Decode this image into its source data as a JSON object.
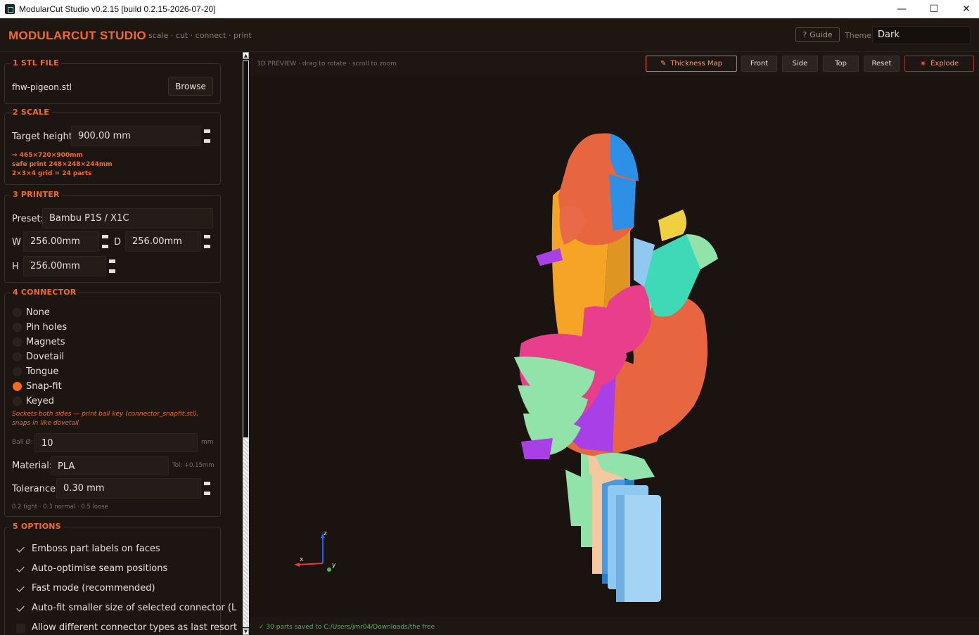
{
  "window": {
    "title": "ModularCut Studio  v0.2.15  [build 0.2.15-2026-07-20]",
    "controls": {
      "minimize": "—",
      "maximize": "☐",
      "close": "✕"
    }
  },
  "header": {
    "brand": "MODULARCUT STUDIO",
    "tagline": "scale · cut · connect · print",
    "guide_label": "Guide",
    "guide_icon": "?",
    "theme_label": "Theme",
    "theme_value": "Dark"
  },
  "stl": {
    "title": "1  STL FILE",
    "filename": "fhw-pigeon.stl",
    "browse_label": "Browse"
  },
  "scale": {
    "title": "2  SCALE",
    "target_label": "Target height:",
    "target_value": "900.00 mm",
    "info": [
      "→ 465×720×900mm",
      "safe print 248×248×244mm",
      "2×3×4 grid = 24 parts"
    ]
  },
  "printer": {
    "title": "3  PRINTER",
    "preset_label": "Preset:",
    "preset_value": "Bambu P1S / X1C",
    "w_label": "W",
    "w_value": "256.00mm",
    "d_label": "D",
    "d_value": "256.00mm",
    "h_label": "H",
    "h_value": "256.00mm"
  },
  "connector": {
    "title": "4  CONNECTOR",
    "options": [
      "None",
      "Pin holes",
      "Magnets",
      "Dovetail",
      "Tongue",
      "Snap-fit",
      "Keyed"
    ],
    "selected": "Snap-fit",
    "description": "Sockets both sides — print ball key (connector_snapfit.stl), snaps in like dovetail",
    "ball_label": "Ball Ø:",
    "ball_value": "10",
    "ball_unit": "mm",
    "material_label": "Material:",
    "material_value": "PLA",
    "tol_hint": "Tol: +0.15mm",
    "tolerance_label": "Tolerance:",
    "tolerance_value": "0.30 mm",
    "tolerance_hint": "0.2 tight · 0.3 normal · 0.5 loose"
  },
  "options": {
    "title": "5  OPTIONS",
    "items": [
      {
        "label": "Emboss part labels on faces",
        "checked": true
      },
      {
        "label": "Auto-optimise seam positions",
        "checked": true
      },
      {
        "label": "Fast mode (recommended)",
        "checked": true
      },
      {
        "label": "Auto-fit smaller size of selected connector (L",
        "checked": true
      },
      {
        "label": "Allow different connector types as last resort",
        "checked": false
      }
    ]
  },
  "viewport": {
    "caption": "3D PREVIEW  ·  drag to rotate  ·  scroll to zoom",
    "buttons": {
      "thickness": "Thickness Map",
      "front": "Front",
      "side": "Side",
      "top": "Top",
      "reset": "Reset",
      "explode": "Explode"
    },
    "axes": {
      "x": "x",
      "y": "y",
      "z": "z"
    },
    "status": "✓   30 parts saved to C:/Users/jmr04/Downloads/the free"
  },
  "colors": {
    "accent": "#f36b21",
    "status_ok": "#3fbf57",
    "part_colors": [
      "#e8663f",
      "#2d8fe6",
      "#f5a425",
      "#e83e8c",
      "#92e3a9",
      "#3fd9b8",
      "#a93fe6",
      "#f5c8a0",
      "#8fc8f0",
      "#f0d040"
    ]
  }
}
